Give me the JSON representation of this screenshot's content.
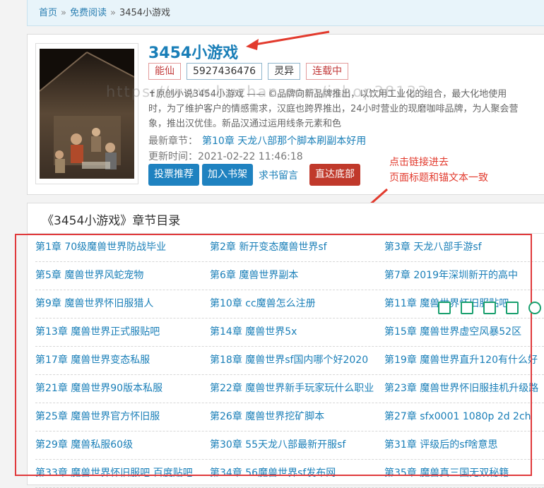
{
  "breadcrumb": {
    "home": "首页",
    "section": "免费阅读",
    "current": "3454小游戏",
    "separator": "»"
  },
  "book": {
    "title": "3454小游戏",
    "tags": [
      "能仙",
      "5927436476",
      "灵异",
      "连载中"
    ],
    "desc_lines": [
      "✝原创小说3454小游戏 —— ©品牌向新品牌推出，以饮用工业化的组合，最大化地使用",
      "时，为了维护客户的情感需求，汉庭也跨界推出，24小时营业的现磨咖啡品牌，为人聚会营",
      "象，推出汉优佳。新品汉通过运用线条元素和色"
    ],
    "latest_label": "最新章节：",
    "latest_chapter": "第10章 天龙八部那个脚本刷副本好用",
    "update_label": "更新时间：",
    "update_time": "2021-02-22 11:46:18",
    "buttons": {
      "vote": "投票推荐",
      "shelf": "加入书架",
      "request": "求书留言",
      "bottom": "直达底部"
    }
  },
  "watermark": "https://www.huzhan.com/ishop38133",
  "annotation": {
    "line1": "点击链接进去",
    "line2": "页面标题和锚文本一致"
  },
  "chapter_list": {
    "title": "《3454小游戏》章节目录",
    "rows": [
      [
        "第1章 70级魔兽世界防战毕业",
        "第2章 新开变态魔兽世界sf",
        "第3章 天龙八部手游sf"
      ],
      [
        "第5章 魔兽世界风蛇宠物",
        "第6章 魔兽世界副本",
        "第7章 2019年深圳新开的高中"
      ],
      [
        "第9章 魔兽世界怀旧服猎人",
        "第10章 cc魔兽怎么注册",
        "第11章 魔兽世界怀旧服贴吧"
      ],
      [
        "第13章 魔兽世界正式服贴吧",
        "第14章 魔兽世界5x",
        "第15章 魔兽世界虚空风暴52区"
      ],
      [
        "第17章 魔兽世界变态私服",
        "第18章 魔兽世界sf国内哪个好2020",
        "第19章 魔兽世界直升120有什么好"
      ],
      [
        "第21章 魔兽世界90版本私服",
        "第22章 魔兽世界新手玩家玩什么职业",
        "第23章 魔兽世界怀旧服挂机升级路"
      ],
      [
        "第25章 魔兽世界官方怀旧服",
        "第26章 魔兽世界挖矿脚本",
        "第27章 sfx0001 1080p 2d 2ch"
      ],
      [
        "第29章 魔兽私服60级",
        "第30章 55天龙八部最新开服sf",
        "第31章 评级后的sf啥意思"
      ],
      [
        "第33章 魔兽世界怀旧服吧 百度贴吧",
        "第34章 56魔兽世界sf发布网",
        "第35章 魔兽真三国无双秘籍"
      ]
    ]
  },
  "colors": {
    "link": "#1a7fb8",
    "accent_red": "#e0393b",
    "button_blue": "#1f82c0",
    "button_red": "#c0392b"
  }
}
